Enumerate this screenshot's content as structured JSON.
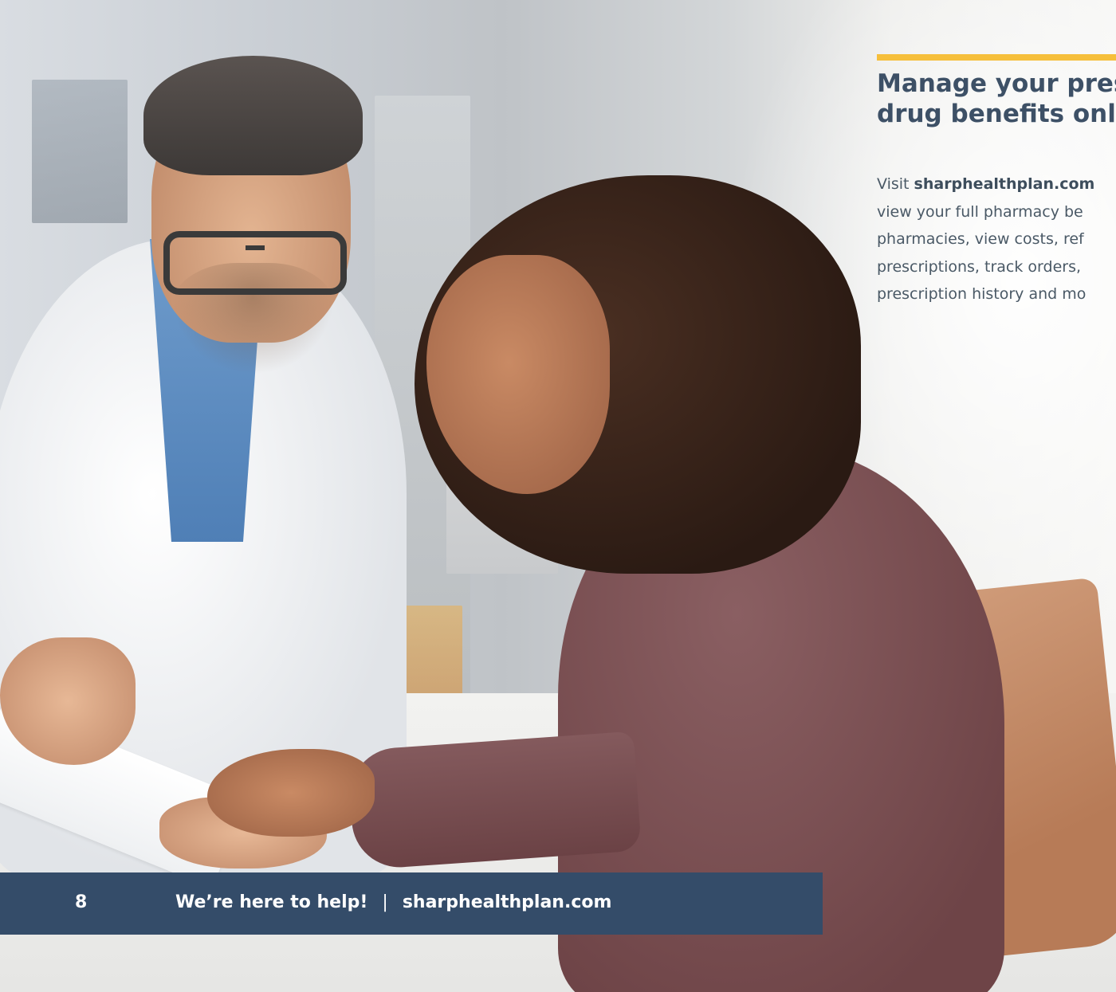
{
  "panel": {
    "heading_lines": [
      "Manage your pres",
      "drug benefits onli"
    ],
    "body_lead": "Visit ",
    "body_link": "sharphealthplan.com",
    "body_lines": [
      "view your full pharmacy be",
      "pharmacies, view costs, ref",
      "prescriptions, track orders,",
      "prescription history and mo"
    ]
  },
  "footer": {
    "page_number": "8",
    "tagline": "We’re here to help!",
    "separator": "|",
    "website": "sharphealthplan.com"
  },
  "colors": {
    "accent": "#f6bf3b",
    "footer_band": "#344c69",
    "heading": "#3d5066"
  }
}
